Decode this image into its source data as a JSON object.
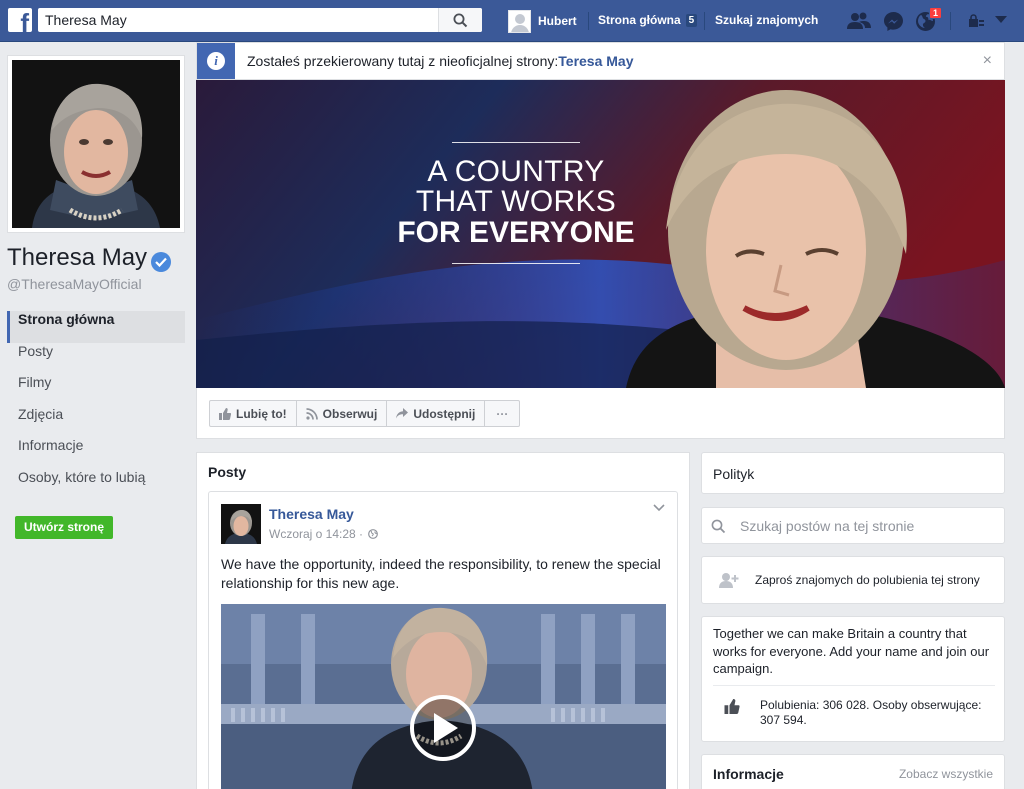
{
  "header": {
    "search_value": "Theresa May",
    "user_name": "Hubert",
    "home_label": "Strona główna",
    "home_count": "5",
    "find_friends_label": "Szukaj znajomych",
    "notifications_count": "1"
  },
  "profile": {
    "name": "Theresa May",
    "handle": "@TheresaMayOfficial"
  },
  "left_nav": {
    "items": [
      {
        "label": "Strona główna",
        "active": true
      },
      {
        "label": "Posty"
      },
      {
        "label": "Filmy"
      },
      {
        "label": "Zdjęcia"
      },
      {
        "label": "Informacje"
      },
      {
        "label": "Osoby, które to lubią"
      }
    ],
    "create_page_label": "Utwórz stronę"
  },
  "banner": {
    "text": "Zostałeś przekierowany tutaj z nieoficjalnej strony:",
    "link": "Teresa May",
    "close": "×"
  },
  "cover": {
    "line1": "A COUNTRY",
    "line2": "THAT WORKS",
    "line3": "FOR EVERYONE"
  },
  "actions": {
    "like": "Lubię to!",
    "follow": "Obserwuj",
    "share": "Udostępnij",
    "more": "···"
  },
  "posts": {
    "title": "Posty",
    "post": {
      "author": "Theresa May",
      "time": "Wczoraj o 14:28 ·",
      "text": "We have the opportunity, indeed the responsibility, to renew the special relationship for this new age."
    }
  },
  "sidebar": {
    "category": "Polityk",
    "search_placeholder": "Szukaj postów na tej stronie",
    "invite": "Zaproś znajomych do polubienia tej strony",
    "about": "Together we can make Britain a country that works for everyone. Add your name and join our campaign.",
    "stats": "Polubienia: 306 028. Osoby obserwujące: 307 594.",
    "info_title": "Informacje",
    "see_all": "Zobacz wszystkie"
  },
  "colors": {
    "topbar": "#3b5998",
    "link": "#365899",
    "create_button": "#42b72a",
    "badge": "#fa3e3e"
  }
}
